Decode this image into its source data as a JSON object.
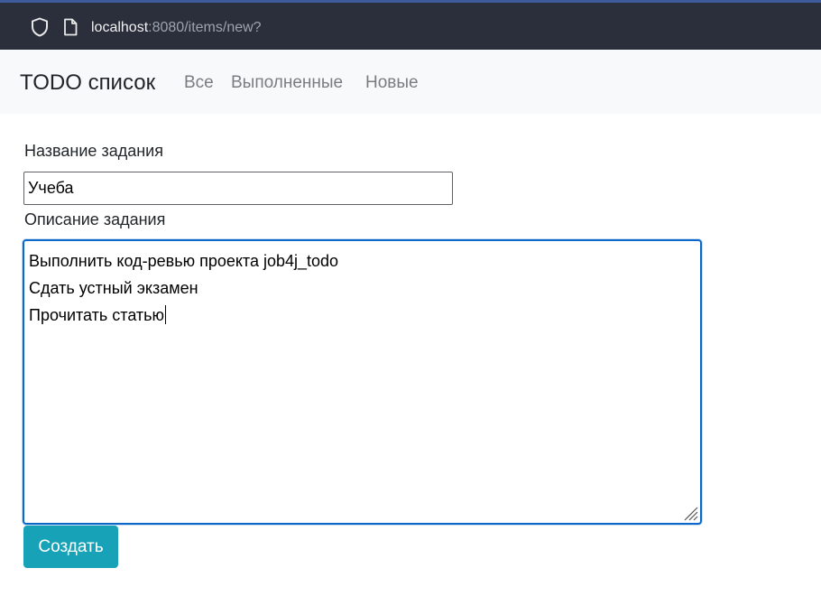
{
  "browser": {
    "url_host": "localhost",
    "url_rest": ":8080/items/new?",
    "icons": [
      "shield-icon",
      "page-icon"
    ]
  },
  "navbar": {
    "brand": "TODO список",
    "links": [
      {
        "label": "Все"
      },
      {
        "label": "Выполненные"
      },
      {
        "label": "Новые"
      }
    ]
  },
  "form": {
    "title_label": "Название задания",
    "title_value": "Учеба",
    "description_label": "Описание задания",
    "description_lines": [
      "Выполнить код-ревью проекта job4j_todo",
      "Сдать устный экзамен",
      "Прочитать статью"
    ],
    "submit_label": "Создать"
  },
  "colors": {
    "browser_bar": "#2b2e3b",
    "navbar_bg": "#f8f9fa",
    "focus_border": "#0b67c9",
    "submit_button": "#17a2b8"
  }
}
